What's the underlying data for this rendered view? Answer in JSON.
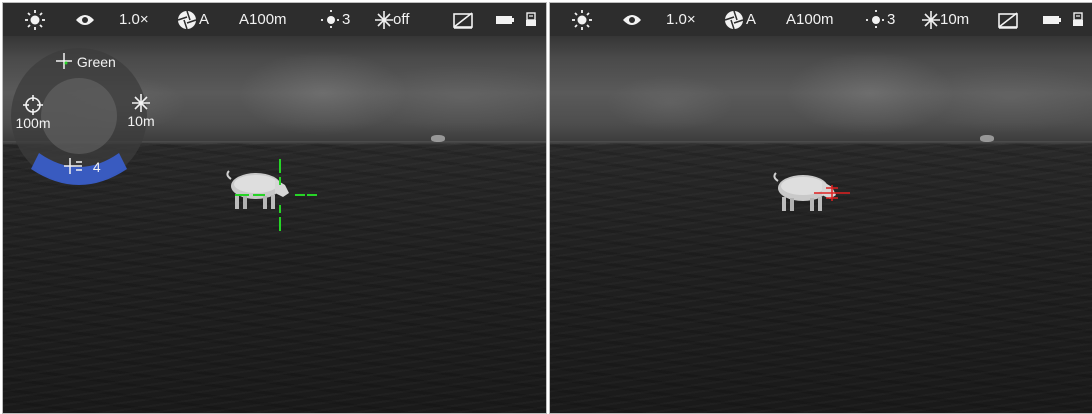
{
  "left_view": {
    "status": {
      "magnification": "1.0×",
      "calibration_mode": "A",
      "rangefinder": "A100m",
      "brightness": "3",
      "stadiametric": "off"
    },
    "radial_menu": {
      "reticle_color": "Green",
      "zero_distance": "100m",
      "stadiametric_distance": "10m",
      "reticle_number": "4"
    },
    "reticle_color_hex": "#27d427"
  },
  "right_view": {
    "status": {
      "magnification": "1.0×",
      "calibration_mode": "A",
      "rangefinder": "A100m",
      "brightness": "3",
      "stadiametric": "10m"
    },
    "reticle_color_hex": "#e02020"
  },
  "icons": [
    "brightness-sun-icon",
    "eye-icon",
    "aperture-icon",
    "brightness-icon",
    "stadiametric-icon",
    "picture-in-picture-off-icon",
    "battery-icon",
    "usb-icon",
    "crosshair-icon",
    "target-icon"
  ],
  "colors": {
    "statusbar_bg": "#2d2d2d",
    "menu_highlight": "#3a5fcf"
  }
}
